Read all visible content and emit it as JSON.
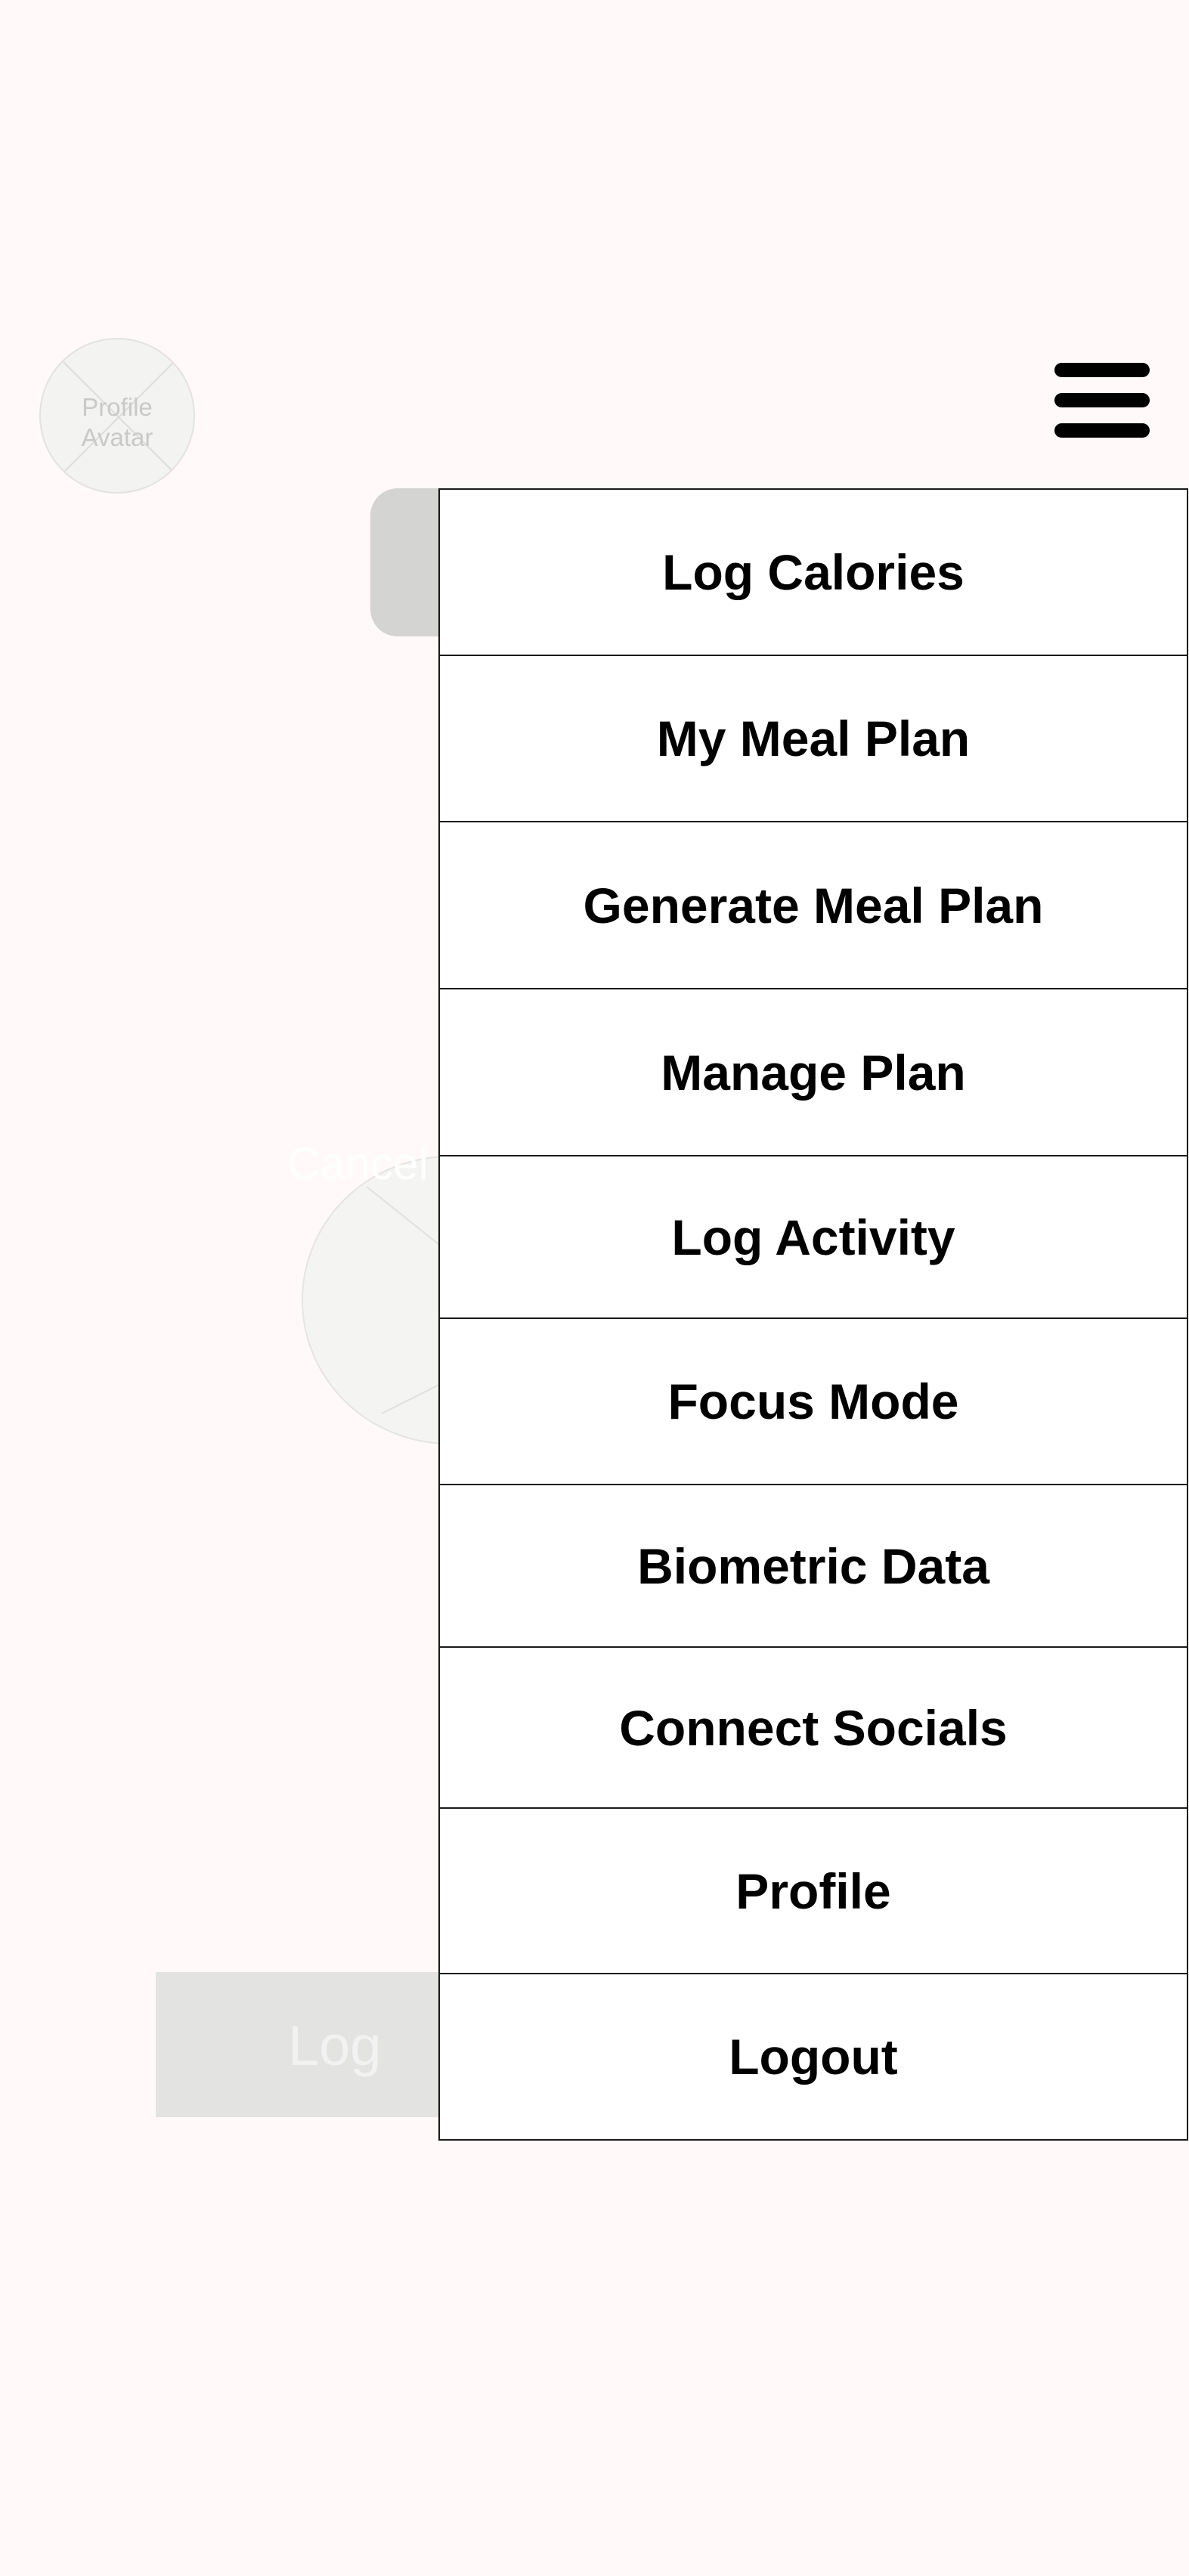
{
  "header": {
    "avatar_label": "Profile\nAvatar"
  },
  "menu": {
    "items": [
      {
        "label": "Log Calories"
      },
      {
        "label": "My Meal Plan"
      },
      {
        "label": "Generate Meal Plan"
      },
      {
        "label": "Manage Plan"
      },
      {
        "label": "Log Activity"
      },
      {
        "label": "Focus Mode"
      },
      {
        "label": "Biometric Data"
      },
      {
        "label": "Connect Socials"
      },
      {
        "label": "Profile"
      },
      {
        "label": "Logout"
      }
    ]
  },
  "background": {
    "cancel_label": "Cancel",
    "log_label": "Log"
  },
  "colors": {
    "page_bg": "#fffaf9",
    "menu_border": "#1a1a1a"
  }
}
